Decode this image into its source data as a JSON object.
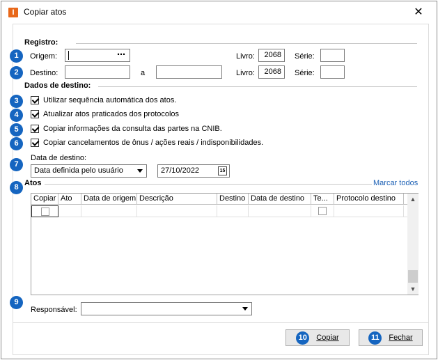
{
  "window": {
    "title": "Copiar atos",
    "app_icon_letter": "I",
    "close_glyph": "✕"
  },
  "registro": {
    "heading": "Registro:",
    "origem_label": "Origem:",
    "origem_value": "",
    "origem_browse": "⋯",
    "destino_label": "Destino:",
    "destino_value": "",
    "a_label": "a",
    "destino_to_value": "",
    "livro_label": "Livro:",
    "origem_livro": "2068",
    "destino_livro": "2068",
    "serie_label": "Série:",
    "origem_serie": "",
    "destino_serie": ""
  },
  "dados": {
    "heading": "Dados de destino:",
    "options": [
      {
        "label": "Utilizar sequência automática dos atos.",
        "checked": true
      },
      {
        "label": "Atualizar atos praticados dos protocolos",
        "checked": true
      },
      {
        "label": "Copiar informações da consulta das partes na CNIB.",
        "checked": true
      },
      {
        "label": "Copiar cancelamentos de ônus / ações reais / indisponibilidades.",
        "checked": true
      }
    ],
    "data_destino_label": "Data de destino:",
    "data_mode": "Data definida pelo usuário",
    "date_value": "27/10/2022",
    "calendar_glyph": "15"
  },
  "atos": {
    "heading": "Atos",
    "marcar_todos": "Marcar todos",
    "columns": [
      "Copiar",
      "Ato",
      "Data de origem",
      "Descrição",
      "Destino",
      "Data de destino",
      "Te...",
      "Protocolo destino"
    ]
  },
  "responsavel": {
    "label": "Responsável:",
    "value": ""
  },
  "buttons": {
    "copiar": "Copiar",
    "fechar": "Fechar"
  },
  "badges": [
    "1",
    "2",
    "3",
    "4",
    "5",
    "6",
    "7",
    "8",
    "9",
    "10",
    "11"
  ],
  "colors": {
    "badge": "#1565c0",
    "link": "#1a5fb4",
    "app_icon": "#e8681a"
  }
}
